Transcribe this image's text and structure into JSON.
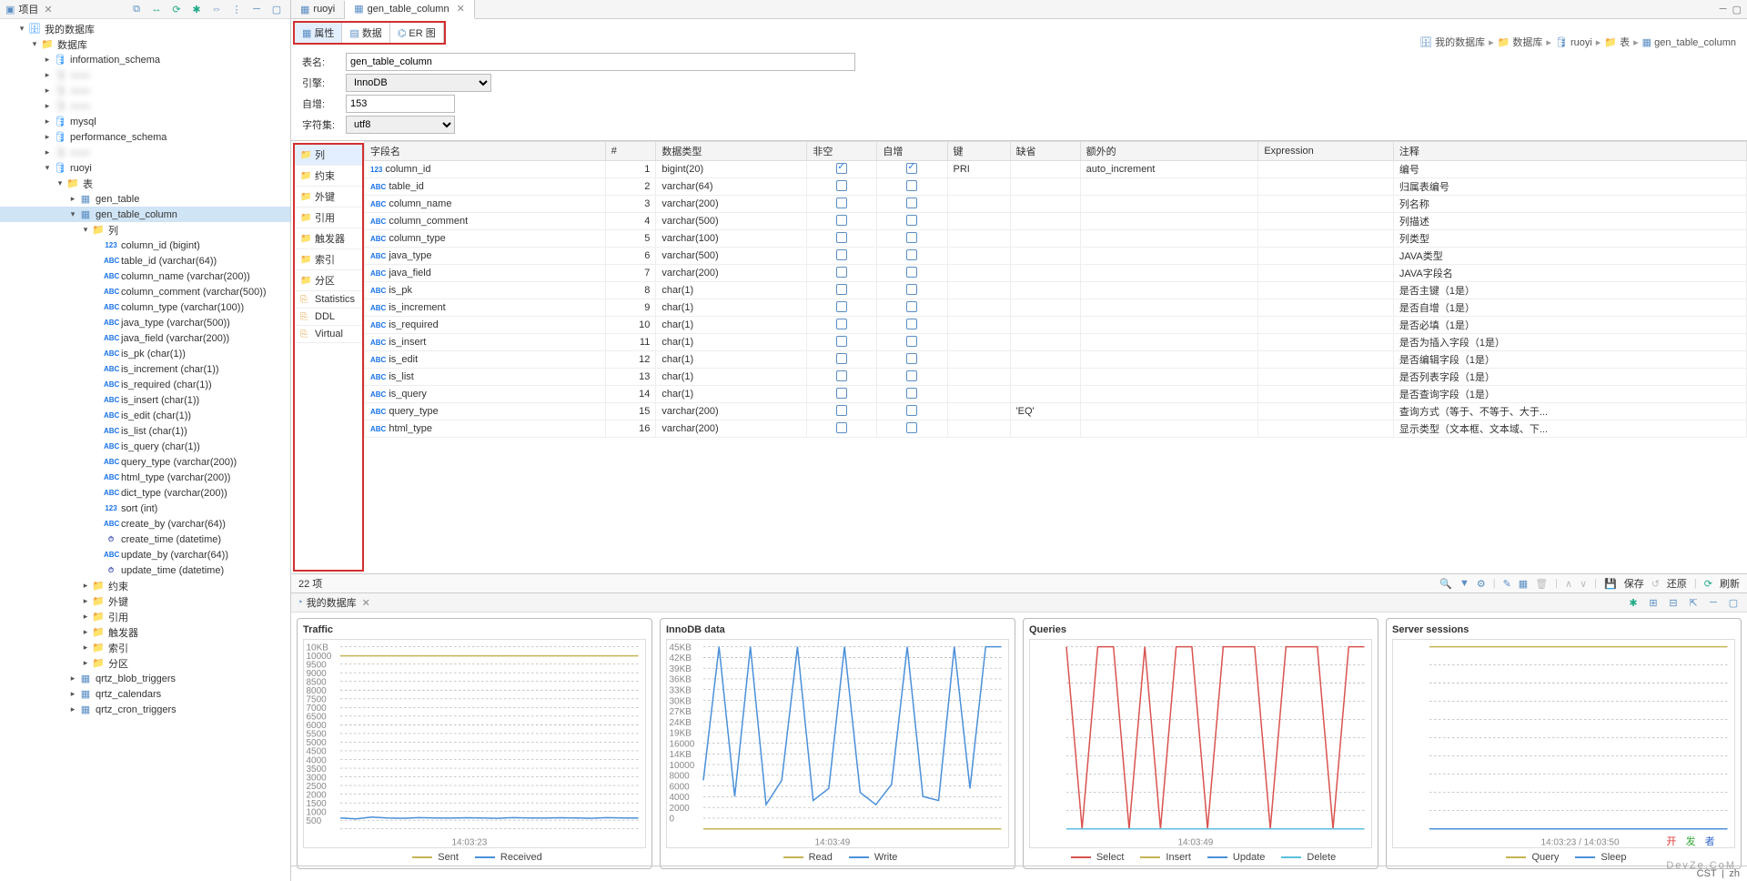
{
  "sidebar": {
    "title": "项目",
    "root": "我的数据库",
    "db_group": "数据库",
    "databases": [
      "information_schema",
      "",
      "",
      "",
      "mysql",
      "performance_schema",
      "",
      "ruoyi"
    ],
    "ruoyi_tables_label": "表",
    "tables": [
      "gen_table",
      "gen_table_column"
    ],
    "cols_label": "列",
    "columns": [
      {
        "name": "column_id",
        "type": "(bigint)",
        "ic": "123"
      },
      {
        "name": "table_id",
        "type": "(varchar(64))",
        "ic": "ABC"
      },
      {
        "name": "column_name",
        "type": "(varchar(200))",
        "ic": "ABC"
      },
      {
        "name": "column_comment",
        "type": "(varchar(500))",
        "ic": "ABC"
      },
      {
        "name": "column_type",
        "type": "(varchar(100))",
        "ic": "ABC"
      },
      {
        "name": "java_type",
        "type": "(varchar(500))",
        "ic": "ABC"
      },
      {
        "name": "java_field",
        "type": "(varchar(200))",
        "ic": "ABC"
      },
      {
        "name": "is_pk",
        "type": "(char(1))",
        "ic": "ABC"
      },
      {
        "name": "is_increment",
        "type": "(char(1))",
        "ic": "ABC"
      },
      {
        "name": "is_required",
        "type": "(char(1))",
        "ic": "ABC"
      },
      {
        "name": "is_insert",
        "type": "(char(1))",
        "ic": "ABC"
      },
      {
        "name": "is_edit",
        "type": "(char(1))",
        "ic": "ABC"
      },
      {
        "name": "is_list",
        "type": "(char(1))",
        "ic": "ABC"
      },
      {
        "name": "is_query",
        "type": "(char(1))",
        "ic": "ABC"
      },
      {
        "name": "query_type",
        "type": "(varchar(200))",
        "ic": "ABC"
      },
      {
        "name": "html_type",
        "type": "(varchar(200))",
        "ic": "ABC"
      },
      {
        "name": "dict_type",
        "type": "(varchar(200))",
        "ic": "ABC"
      },
      {
        "name": "sort",
        "type": "(int)",
        "ic": "123"
      },
      {
        "name": "create_by",
        "type": "(varchar(64))",
        "ic": "ABC"
      },
      {
        "name": "create_time",
        "type": "(datetime)",
        "ic": "⏱"
      },
      {
        "name": "update_by",
        "type": "(varchar(64))",
        "ic": "ABC"
      },
      {
        "name": "update_time",
        "type": "(datetime)",
        "ic": "⏱"
      }
    ],
    "table_folders": [
      "约束",
      "外键",
      "引用",
      "触发器",
      "索引",
      "分区"
    ],
    "after_nodes": [
      "qrtz_blob_triggers",
      "qrtz_calendars",
      "qrtz_cron_triggers"
    ]
  },
  "editor_tabs": [
    {
      "label": "ruoyi",
      "active": false
    },
    {
      "label": "gen_table_column",
      "active": true
    }
  ],
  "sub_tabs": [
    "属性",
    "数据",
    "ER 图"
  ],
  "breadcrumb": [
    "我的数据库",
    "数据库",
    "ruoyi",
    "表",
    "gen_table_column"
  ],
  "form": {
    "name_label": "表名:",
    "name_value": "gen_table_column",
    "engine_label": "引擎:",
    "engine_value": "InnoDB",
    "autoinc_label": "自增:",
    "autoinc_value": "153",
    "charset_label": "字符集:",
    "charset_value": "utf8"
  },
  "subnav": [
    "列",
    "约束",
    "外键",
    "引用",
    "触发器",
    "索引",
    "分区",
    "Statistics",
    "DDL",
    "Virtual"
  ],
  "grid_headers": [
    "字段名",
    "#",
    "数据类型",
    "非空",
    "自增",
    "键",
    "缺省",
    "额外的",
    "Expression",
    "注释"
  ],
  "grid_rows": [
    {
      "name": "column_id",
      "idx": 1,
      "dtype": "bigint(20)",
      "nn": true,
      "ai": true,
      "key": "PRI",
      "extra": "auto_increment",
      "comment": "编号",
      "pref": "123"
    },
    {
      "name": "table_id",
      "idx": 2,
      "dtype": "varchar(64)",
      "nn": false,
      "ai": false,
      "key": "",
      "extra": "",
      "comment": "归属表编号",
      "pref": "ABC"
    },
    {
      "name": "column_name",
      "idx": 3,
      "dtype": "varchar(200)",
      "nn": false,
      "ai": false,
      "key": "",
      "extra": "",
      "comment": "列名称",
      "pref": "ABC"
    },
    {
      "name": "column_comment",
      "idx": 4,
      "dtype": "varchar(500)",
      "nn": false,
      "ai": false,
      "key": "",
      "extra": "",
      "comment": "列描述",
      "pref": "ABC"
    },
    {
      "name": "column_type",
      "idx": 5,
      "dtype": "varchar(100)",
      "nn": false,
      "ai": false,
      "key": "",
      "extra": "",
      "comment": "列类型",
      "pref": "ABC"
    },
    {
      "name": "java_type",
      "idx": 6,
      "dtype": "varchar(500)",
      "nn": false,
      "ai": false,
      "key": "",
      "extra": "",
      "comment": "JAVA类型",
      "pref": "ABC"
    },
    {
      "name": "java_field",
      "idx": 7,
      "dtype": "varchar(200)",
      "nn": false,
      "ai": false,
      "key": "",
      "extra": "",
      "comment": "JAVA字段名",
      "pref": "ABC"
    },
    {
      "name": "is_pk",
      "idx": 8,
      "dtype": "char(1)",
      "nn": false,
      "ai": false,
      "key": "",
      "extra": "",
      "comment": "是否主键（1是）",
      "pref": "ABC"
    },
    {
      "name": "is_increment",
      "idx": 9,
      "dtype": "char(1)",
      "nn": false,
      "ai": false,
      "key": "",
      "extra": "",
      "comment": "是否自增（1是）",
      "pref": "ABC"
    },
    {
      "name": "is_required",
      "idx": 10,
      "dtype": "char(1)",
      "nn": false,
      "ai": false,
      "key": "",
      "extra": "",
      "comment": "是否必填（1是）",
      "pref": "ABC"
    },
    {
      "name": "is_insert",
      "idx": 11,
      "dtype": "char(1)",
      "nn": false,
      "ai": false,
      "key": "",
      "extra": "",
      "comment": "是否为插入字段（1是）",
      "pref": "ABC"
    },
    {
      "name": "is_edit",
      "idx": 12,
      "dtype": "char(1)",
      "nn": false,
      "ai": false,
      "key": "",
      "extra": "",
      "comment": "是否编辑字段（1是）",
      "pref": "ABC"
    },
    {
      "name": "is_list",
      "idx": 13,
      "dtype": "char(1)",
      "nn": false,
      "ai": false,
      "key": "",
      "extra": "",
      "comment": "是否列表字段（1是）",
      "pref": "ABC"
    },
    {
      "name": "is_query",
      "idx": 14,
      "dtype": "char(1)",
      "nn": false,
      "ai": false,
      "key": "",
      "extra": "",
      "comment": "是否查询字段（1是）",
      "pref": "ABC"
    },
    {
      "name": "query_type",
      "idx": 15,
      "dtype": "varchar(200)",
      "nn": false,
      "ai": false,
      "key": "",
      "extra": "",
      "def": "'EQ'",
      "comment": "查询方式（等于、不等于、大于...",
      "pref": "ABC"
    },
    {
      "name": "html_type",
      "idx": 16,
      "dtype": "varchar(200)",
      "nn": false,
      "ai": false,
      "key": "",
      "extra": "",
      "comment": "显示类型（文本框、文本域、下...",
      "pref": "ABC"
    }
  ],
  "status": {
    "items": "22 项",
    "refresh": "刷新",
    "save": "保存",
    "revert": "还原"
  },
  "bottom": {
    "title": "我的数据库",
    "charts": [
      {
        "title": "Traffic",
        "legend": [
          "Sent",
          "Received"
        ],
        "colors": [
          "sent",
          "recv"
        ],
        "xLabel": "14:03:23"
      },
      {
        "title": "InnoDB data",
        "legend": [
          "Read",
          "Write"
        ],
        "colors": [
          "rd",
          "wr"
        ],
        "xLabel": "14:03:49"
      },
      {
        "title": "Queries",
        "legend": [
          "Select",
          "Insert",
          "Update",
          "Delete"
        ],
        "colors": [
          "sel",
          "ins",
          "upd",
          "del"
        ],
        "xLabel": "14:03:49"
      },
      {
        "title": "Server sessions",
        "legend": [
          "Query",
          "Sleep"
        ],
        "colors": [
          "qry",
          "slp"
        ],
        "xLabel": "14:03:23 / 14:03:50"
      }
    ]
  },
  "footer": {
    "tz": "CST",
    "lang": "zh"
  },
  "watermark": "DevZe.CoM",
  "chart_data": [
    {
      "type": "line",
      "title": "Traffic",
      "x": [
        0,
        1,
        2,
        3,
        4,
        5,
        6,
        7,
        8,
        9,
        10,
        11,
        12,
        13,
        14,
        15,
        16,
        17,
        18,
        19
      ],
      "series": [
        {
          "name": "Sent",
          "values": [
            9500,
            9500,
            9500,
            9500,
            9500,
            9500,
            9500,
            9500,
            9500,
            9500,
            9500,
            9500,
            9500,
            9500,
            9500,
            9500,
            9500,
            9500,
            9500,
            9500
          ]
        },
        {
          "name": "Received",
          "values": [
            600,
            550,
            650,
            600,
            580,
            620,
            600,
            590,
            610,
            600,
            580,
            620,
            600,
            590,
            610,
            600,
            580,
            620,
            600,
            590
          ]
        }
      ],
      "ylim": [
        0,
        10000
      ],
      "yticks": [
        "10KB",
        "10000",
        "9500",
        "9000",
        "8500",
        "8000",
        "7500",
        "7000",
        "6500",
        "6000",
        "5500",
        "5000",
        "4500",
        "4000",
        "3500",
        "3000",
        "2500",
        "2000",
        "1500",
        "1000",
        "500"
      ]
    },
    {
      "type": "line",
      "title": "InnoDB data",
      "x": [
        0,
        1,
        2,
        3,
        4,
        5,
        6,
        7,
        8,
        9,
        10,
        11,
        12,
        13,
        14,
        15,
        16,
        17,
        18,
        19
      ],
      "series": [
        {
          "name": "Read",
          "values": [
            0,
            0,
            0,
            0,
            0,
            0,
            0,
            0,
            0,
            0,
            0,
            0,
            0,
            0,
            0,
            0,
            0,
            0,
            0,
            0
          ]
        },
        {
          "name": "Write",
          "values": [
            12000,
            45000,
            8000,
            45000,
            6000,
            12000,
            45000,
            7000,
            10000,
            45000,
            9000,
            6000,
            11000,
            45000,
            8000,
            7000,
            45000,
            10000,
            45000,
            45000
          ]
        }
      ],
      "ylim": [
        0,
        45000
      ],
      "yticks": [
        "45KB",
        "42KB",
        "39KB",
        "36KB",
        "33KB",
        "30KB",
        "27KB",
        "24KB",
        "19KB",
        "16000",
        "14KB",
        "10000",
        "8000",
        "6000",
        "4000",
        "2000",
        "0"
      ]
    },
    {
      "type": "line",
      "title": "Queries",
      "x": [
        0,
        1,
        2,
        3,
        4,
        5,
        6,
        7,
        8,
        9,
        10,
        11,
        12,
        13,
        14,
        15,
        16,
        17,
        18,
        19
      ],
      "series": [
        {
          "name": "Select",
          "values": [
            1,
            0,
            1,
            1,
            0,
            1,
            0,
            1,
            1,
            0,
            1,
            1,
            1,
            0,
            1,
            1,
            1,
            0,
            1,
            1
          ]
        },
        {
          "name": "Insert",
          "values": [
            0,
            0,
            0,
            0,
            0,
            0,
            0,
            0,
            0,
            0,
            0,
            0,
            0,
            0,
            0,
            0,
            0,
            0,
            0,
            0
          ]
        },
        {
          "name": "Update",
          "values": [
            0,
            0,
            0,
            0,
            0,
            0,
            0,
            0,
            0,
            0,
            0,
            0,
            0,
            0,
            0,
            0,
            0,
            0,
            0,
            0
          ]
        },
        {
          "name": "Delete",
          "values": [
            0,
            0,
            0,
            0,
            0,
            0,
            0,
            0,
            0,
            0,
            0,
            0,
            0,
            0,
            0,
            0,
            0,
            0,
            0,
            0
          ]
        }
      ],
      "ylim": [
        0,
        1
      ]
    },
    {
      "type": "line",
      "title": "Server sessions",
      "x": [
        0,
        1,
        2,
        3,
        4,
        5,
        6,
        7,
        8,
        9,
        10,
        11,
        12,
        13,
        14,
        15,
        16,
        17,
        18,
        19
      ],
      "series": [
        {
          "name": "Query",
          "values": [
            1,
            1,
            1,
            1,
            1,
            1,
            1,
            1,
            1,
            1,
            1,
            1,
            1,
            1,
            1,
            1,
            1,
            1,
            1,
            1
          ]
        },
        {
          "name": "Sleep",
          "values": [
            0,
            0,
            0,
            0,
            0,
            0,
            0,
            0,
            0,
            0,
            0,
            0,
            0,
            0,
            0,
            0,
            0,
            0,
            0,
            0
          ]
        }
      ],
      "ylim": [
        0,
        1
      ]
    }
  ]
}
